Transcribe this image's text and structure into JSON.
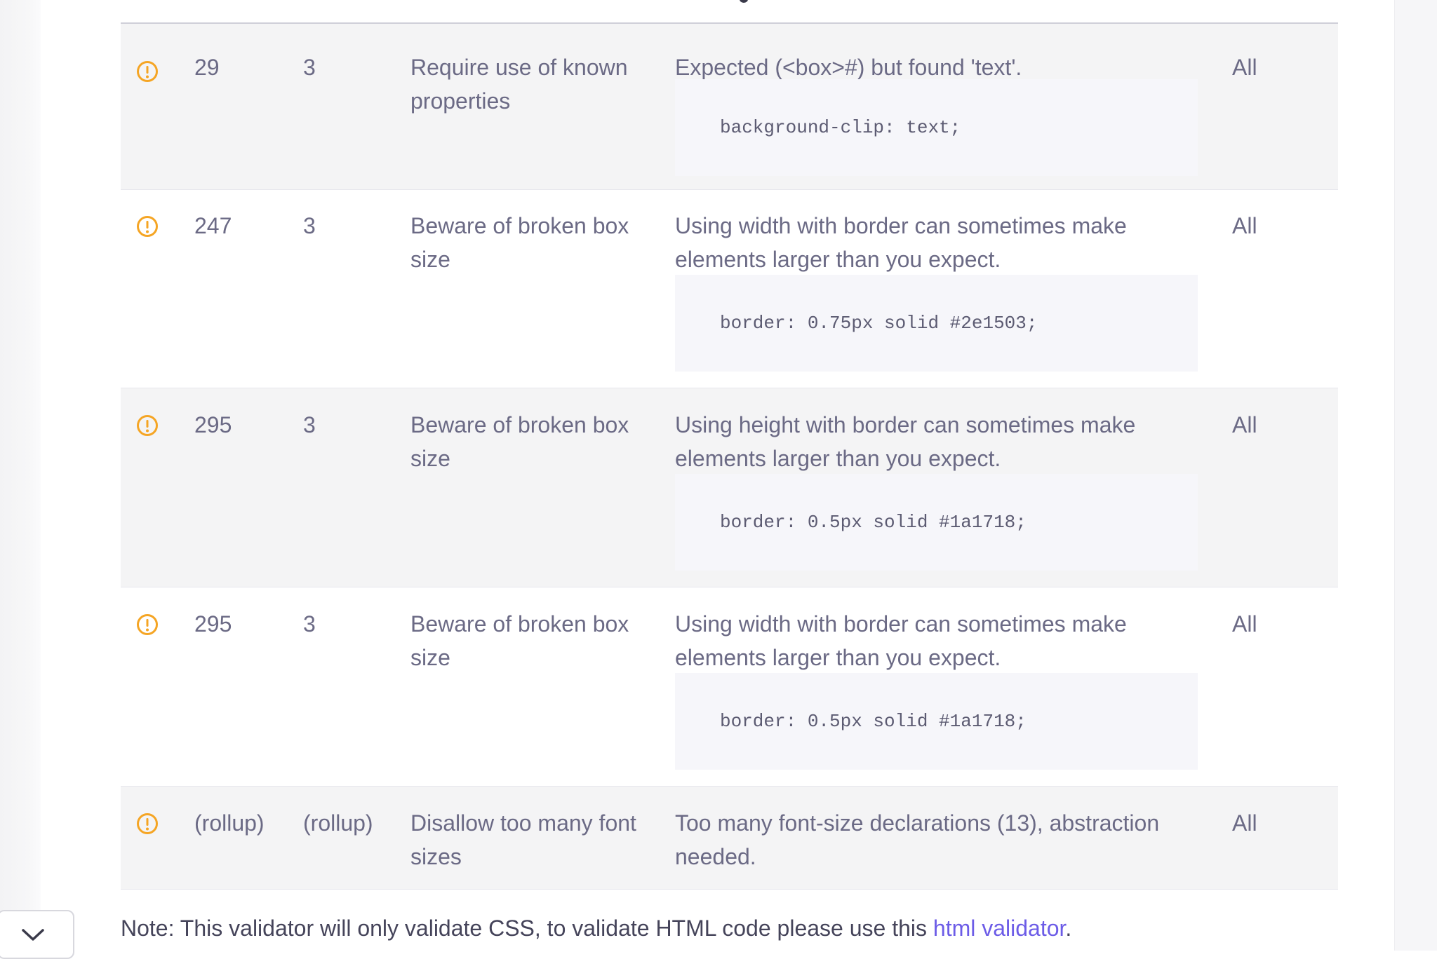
{
  "colors": {
    "warning_icon": "#f5a524",
    "link": "#6c5ce7",
    "row_shaded": "#f4f4f5",
    "code_background": "#f6f6fa",
    "text": "#6b6a85"
  },
  "results": [
    {
      "icon": "warning-icon",
      "line": "29",
      "column": "3",
      "rule": "Require use of known properties",
      "message": "Expected (<box>#) but found 'text'.",
      "code": "background-clip: text;",
      "media": "All"
    },
    {
      "icon": "warning-icon",
      "line": "247",
      "column": "3",
      "rule": "Beware of broken box size",
      "message": "Using width with border can sometimes make elements larger than you expect.",
      "code": "border: 0.75px solid #2e1503;",
      "media": "All"
    },
    {
      "icon": "warning-icon",
      "line": "295",
      "column": "3",
      "rule": "Beware of broken box size",
      "message": "Using height with border can sometimes make elements larger than you expect.",
      "code": "border: 0.5px solid #1a1718;",
      "media": "All"
    },
    {
      "icon": "warning-icon",
      "line": "295",
      "column": "3",
      "rule": "Beware of broken box size",
      "message": "Using width with border can sometimes make elements larger than you expect.",
      "code": "border: 0.5px solid #1a1718;",
      "media": "All"
    },
    {
      "icon": "warning-icon",
      "line": "(rollup)",
      "column": "(rollup)",
      "rule": "Disallow too many font sizes",
      "message": "Too many font-size declarations (13), abstraction needed.",
      "media": "All"
    }
  ],
  "note": {
    "prefix": "Note: This validator will only validate CSS, to validate HTML code please use this ",
    "link_text": "html validator",
    "suffix": "."
  },
  "collapse_toggle": {
    "icon": "chevron-down-icon"
  }
}
